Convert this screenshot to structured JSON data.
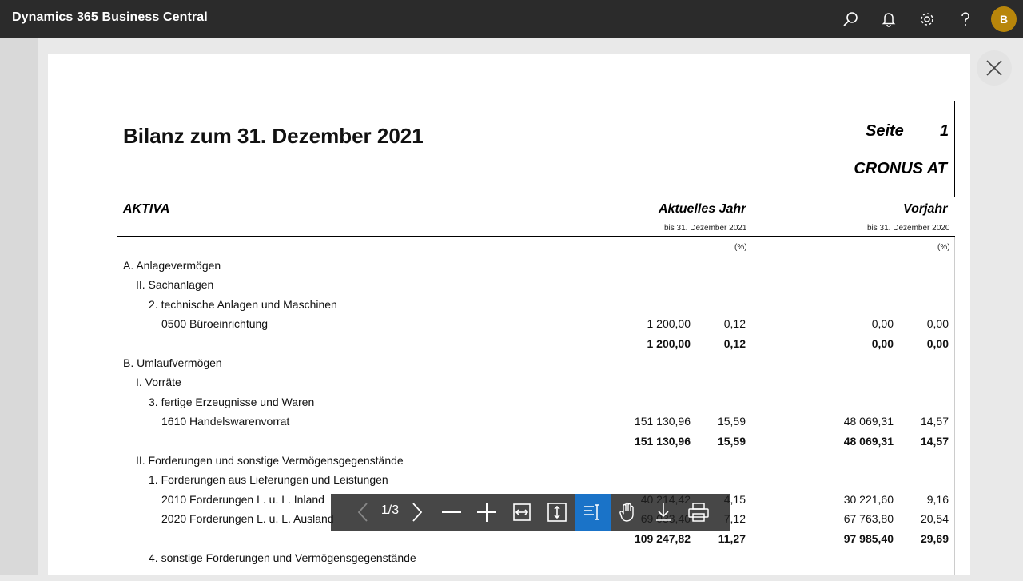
{
  "app": {
    "title": "Dynamics 365 Business Central",
    "avatar_initial": "B"
  },
  "topbar_icons": [
    "search-icon",
    "bell-icon",
    "gear-icon",
    "help-icon"
  ],
  "report": {
    "title": "Bilanz zum 31. Dezember 2021",
    "page_label": "Seite",
    "page_number": "1",
    "company": "CRONUS AT",
    "section_label": "AKTIVA",
    "col_current": "Aktuelles Jahr",
    "col_current_sub": "bis 31. Dezember 2021",
    "col_prior": "Vorjahr",
    "col_prior_sub": "bis 31. Dezember 2020",
    "pct_label": "(%)",
    "rows": [
      {
        "label": "A. Anlagevermögen",
        "indent": 0
      },
      {
        "label": "II. Sachanlagen",
        "indent": 1
      },
      {
        "label": "2. technische Anlagen und Maschinen",
        "indent": 2
      },
      {
        "label": "0500 Büroeinrichtung",
        "indent": 3,
        "cur": "1 200,00",
        "cur_pct": "0,12",
        "prev": "0,00",
        "prev_pct": "0,00"
      },
      {
        "label": "",
        "indent": 3,
        "bold": true,
        "cur": "1 200,00",
        "cur_pct": "0,12",
        "prev": "0,00",
        "prev_pct": "0,00"
      },
      {
        "label": "B. Umlaufvermögen",
        "indent": 0
      },
      {
        "label": "I. Vorräte",
        "indent": 1
      },
      {
        "label": "3. fertige Erzeugnisse und Waren",
        "indent": 2
      },
      {
        "label": "1610 Handelswarenvorrat",
        "indent": 3,
        "cur": "151 130,96",
        "cur_pct": "15,59",
        "prev": "48 069,31",
        "prev_pct": "14,57"
      },
      {
        "label": "",
        "indent": 3,
        "bold": true,
        "cur": "151 130,96",
        "cur_pct": "15,59",
        "prev": "48 069,31",
        "prev_pct": "14,57"
      },
      {
        "label": "II. Forderungen und sonstige Vermögensgegenstände",
        "indent": 1
      },
      {
        "label": "1. Forderungen aus Lieferungen und Leistungen",
        "indent": 2
      },
      {
        "label": "2010 Forderungen L. u. L. Inland",
        "indent": 3,
        "cur": "40 214,42",
        "cur_pct": "4,15",
        "prev": "30 221,60",
        "prev_pct": "9,16"
      },
      {
        "label": "2020 Forderungen L. u. L. Ausland",
        "indent": 3,
        "cur": "69 033,40",
        "cur_pct": "7,12",
        "prev": "67 763,80",
        "prev_pct": "20,54"
      },
      {
        "label": "",
        "indent": 3,
        "bold": true,
        "cur": "109 247,82",
        "cur_pct": "11,27",
        "prev": "97 985,40",
        "prev_pct": "29,69"
      },
      {
        "label": "4. sonstige Forderungen und Vermögensgegenstände",
        "indent": 2
      }
    ]
  },
  "viewer_toolbar": {
    "page_indicator": "1/3",
    "tools": [
      "prev-page",
      "next-page",
      "zoom-out",
      "zoom-in",
      "fit-width",
      "fit-page",
      "text-select",
      "hand-pan",
      "download",
      "print"
    ]
  },
  "colors": {
    "topbar": "#2b2b2b",
    "accent": "#1a73c8",
    "avatar": "#b8860b"
  }
}
